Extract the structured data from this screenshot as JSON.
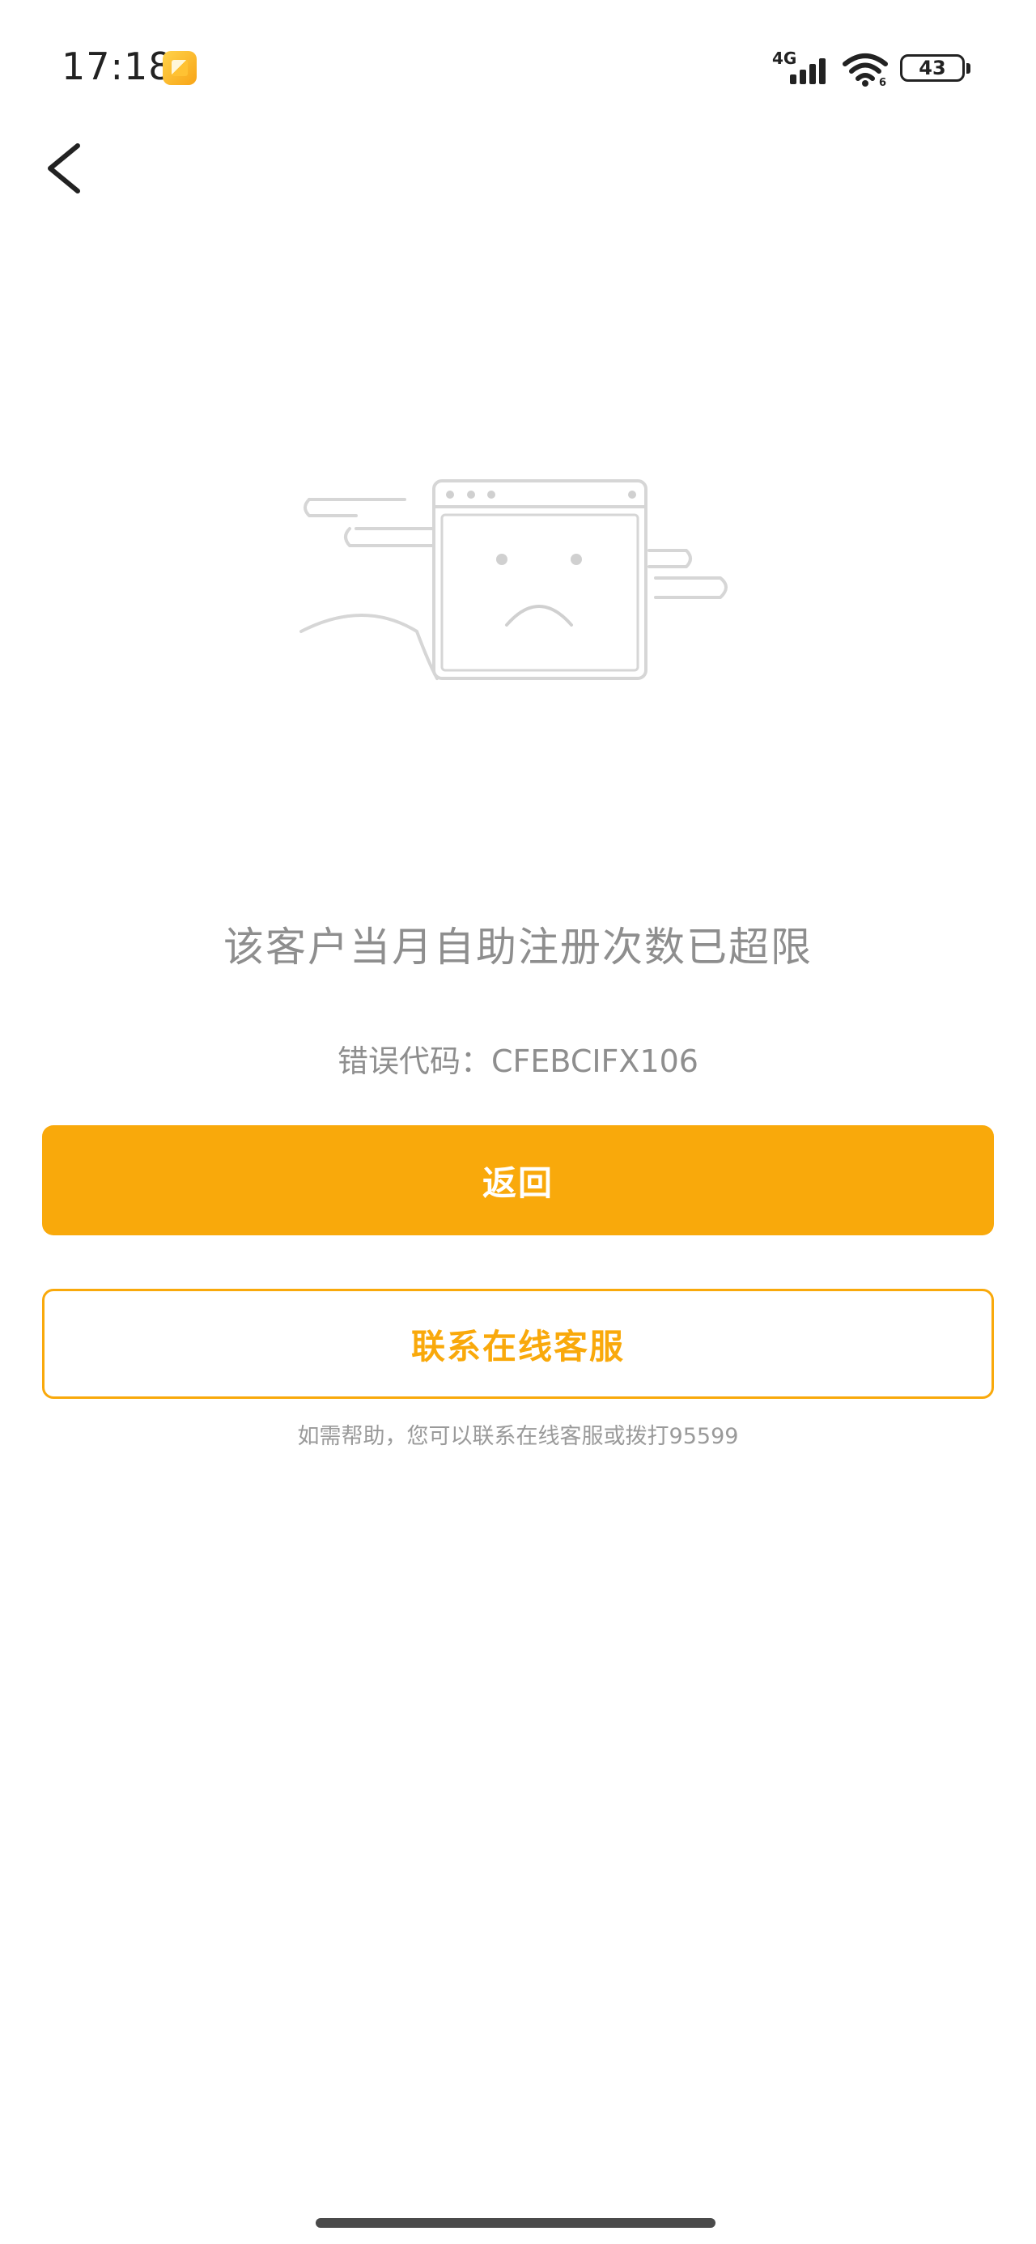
{
  "status_bar": {
    "time": "17:18",
    "network": "4G",
    "wifi_badge": "6",
    "battery": "43",
    "notification_icon": "gallery-notification-icon"
  },
  "header": {
    "back_icon": "chevron-left-icon"
  },
  "illustration": {
    "icon": "sad-browser-window-illustration"
  },
  "message": {
    "title": "该客户当月自助注册次数已超限",
    "error_code_line": "错误代码：CFEBCIFX106"
  },
  "actions": {
    "back_label": "返回",
    "contact_label": "联系在线客服"
  },
  "help": {
    "text": "如需帮助，您可以联系在线客服或拨打95599"
  },
  "colors": {
    "accent": "#f9a90b",
    "muted_text": "#8e8e8e",
    "illustration_stroke": "#d4d4d4"
  }
}
